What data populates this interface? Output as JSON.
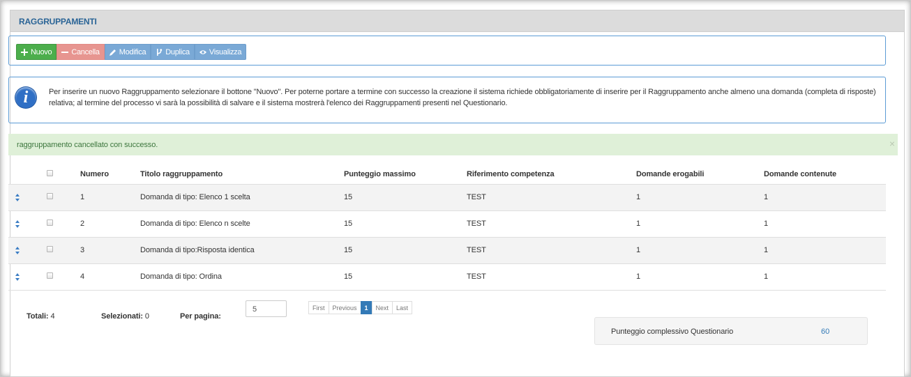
{
  "panel": {
    "title": "RAGGRUPPAMENTI"
  },
  "toolbar": {
    "new_label": "Nuovo",
    "delete_label": "Cancella",
    "edit_label": "Modifica",
    "duplicate_label": "Duplica",
    "view_label": "Visualizza"
  },
  "info": {
    "text": "Per inserire un nuovo Raggruppamento selezionare il bottone \"Nuovo\". Per poterne portare a termine con successo la creazione il sistema richiede obbligatoriamente di inserire per il Raggruppamento anche almeno una domanda (completa di risposte) relativa; al termine del processo vi sarà la possibilità di salvare e il sistema mostrerà l'elenco dei Raggruppamenti presenti nel Questionario."
  },
  "alert": {
    "text": "raggruppamento cancellato con successo.",
    "close": "×"
  },
  "table": {
    "headers": {
      "numero": "Numero",
      "titolo": "Titolo raggruppamento",
      "punteggio": "Punteggio massimo",
      "riferimento": "Riferimento competenza",
      "erogabili": "Domande erogabili",
      "contenute": "Domande contenute"
    },
    "rows": [
      {
        "numero": "1",
        "titolo": "Domanda di tipo: Elenco 1 scelta",
        "punteggio": "15",
        "riferimento": "TEST",
        "erogabili": "1",
        "contenute": "1"
      },
      {
        "numero": "2",
        "titolo": "Domanda di tipo: Elenco n scelte",
        "punteggio": "15",
        "riferimento": "TEST",
        "erogabili": "1",
        "contenute": "1"
      },
      {
        "numero": "3",
        "titolo": "Domanda di tipo:Risposta identica",
        "punteggio": "15",
        "riferimento": "TEST",
        "erogabili": "1",
        "contenute": "1"
      },
      {
        "numero": "4",
        "titolo": "Domanda di tipo: Ordina",
        "punteggio": "15",
        "riferimento": "TEST",
        "erogabili": "1",
        "contenute": "1"
      }
    ]
  },
  "footer": {
    "totali_label": "Totali:",
    "totali_value": "4",
    "selezionati_label": "Selezionati:",
    "selezionati_value": "0",
    "perpagina_label": "Per pagina:",
    "perpagina_value": "5"
  },
  "pager": {
    "first": "First",
    "previous": "Previous",
    "current": "1",
    "next": "Next",
    "last": "Last"
  },
  "score": {
    "label": "Punteggio complessivo Questionario",
    "value": "60"
  },
  "colors": {
    "accent": "#337ab7",
    "success_bg": "#dff0d8",
    "new_button": "#4cae4c",
    "delete_button": "#e79590",
    "blue_button": "#7aa9d6"
  }
}
